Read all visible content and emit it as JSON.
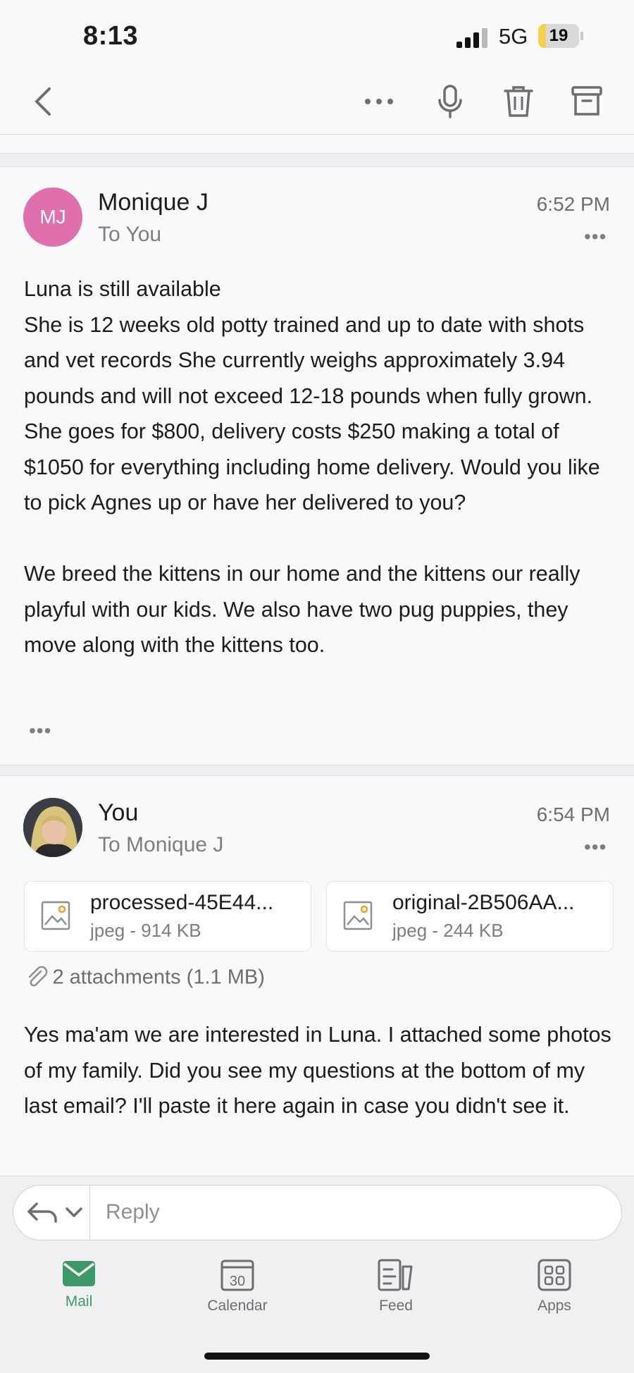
{
  "status_bar": {
    "time": "8:13",
    "network": "5G",
    "battery": "19",
    "battery_level": 0.19
  },
  "nav": {
    "icons": [
      "back-chevron-icon",
      "more-icon",
      "microphone-icon",
      "trash-icon",
      "archive-icon"
    ]
  },
  "messages": [
    {
      "avatar_initials": "MJ",
      "avatar_color": "#e06fae",
      "sender": "Monique J",
      "recipient": "To You",
      "time": "6:52 PM",
      "more": "•••",
      "body": "Luna is still available\nShe is 12 weeks old potty trained and up to date with shots and vet records She currently weighs approximately 3.94 pounds and will not exceed 12-18 pounds when fully grown. She goes for $800, delivery costs $250 making a total of $1050 for everything including home delivery. Would you like to pick Agnes up or have her delivered to you?\n\nWe breed the kittens in our home and the kittens our really playful with our kids. We also have two pug puppies, they move along with the kittens too.",
      "expand": "•••"
    },
    {
      "sender": "You",
      "recipient": "To Monique J",
      "time": "6:54 PM",
      "more": "•••",
      "attachments": [
        {
          "name": "processed-45E44...",
          "meta": "jpeg - 914 KB"
        },
        {
          "name": "original-2B506AA...",
          "meta": "jpeg - 244 KB"
        }
      ],
      "attachments_summary": "2 attachments (1.1 MB)",
      "body": "Yes ma'am we are interested in Luna. I attached some photos of my family. Did you see my questions at the bottom of my last email? I'll paste it here again in case you didn't see it."
    }
  ],
  "reply": {
    "placeholder": "Reply"
  },
  "tabs": [
    {
      "label": "Mail",
      "icon": "mail-icon",
      "active": true
    },
    {
      "label": "Calendar",
      "icon": "calendar-icon",
      "day": "30"
    },
    {
      "label": "Feed",
      "icon": "feed-icon"
    },
    {
      "label": "Apps",
      "icon": "apps-icon"
    }
  ],
  "colors": {
    "accent": "#3d9a68",
    "avatar_mj": "#e06fae",
    "battery_fill": "#f5d04a"
  }
}
